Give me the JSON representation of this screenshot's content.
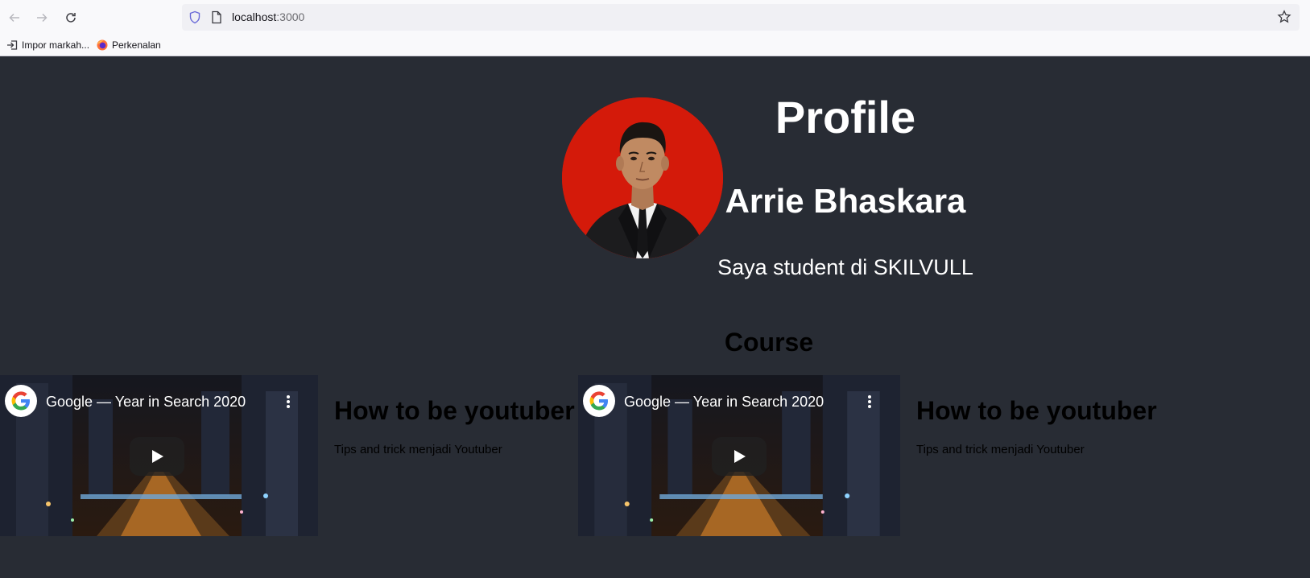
{
  "browser": {
    "url_host": "localhost",
    "url_port": ":3000",
    "bookmarks": [
      {
        "label": "Impor markah...",
        "icon": "import-icon"
      },
      {
        "label": "Perkenalan",
        "icon": "firefox-icon"
      }
    ]
  },
  "profile": {
    "heading": "Profile",
    "name": "Arrie Bhaskara",
    "description": "Saya student di SKILVULL",
    "avatar_bg": "#d41a0a"
  },
  "course": {
    "heading": "Course",
    "items": [
      {
        "video_title": "Google — Year in Search 2020",
        "title": "How to be youtuber",
        "description": "Tips and trick menjadi Youtuber"
      },
      {
        "video_title": "Google — Year in Search 2020",
        "title": "How to be youtuber",
        "description": "Tips and trick menjadi Youtuber"
      }
    ]
  },
  "colors": {
    "page_bg": "#282c34",
    "chrome_bg": "#f9f9fb"
  }
}
